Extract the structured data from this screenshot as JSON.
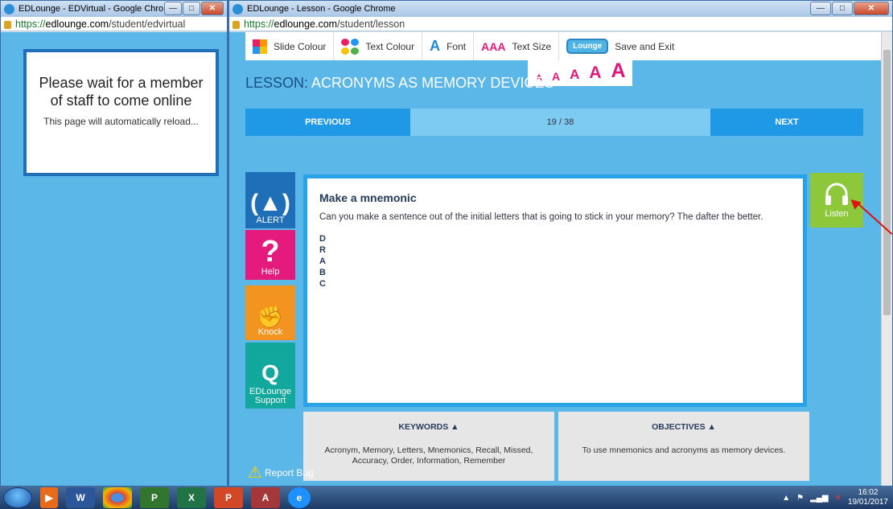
{
  "left_window": {
    "title": "EDLounge - EDVirtual - Google Chro...",
    "url_scheme": "https://",
    "url_domain": "edlounge.com",
    "url_path": "/student/edvirtual",
    "wait_message": "Please wait for a member of staff to come online",
    "reload_message": "This page will automatically reload..."
  },
  "right_window": {
    "title": "EDLounge - Lesson - Google Chrome",
    "url_scheme": "https://",
    "url_domain": "edlounge.com",
    "url_path": "/student/lesson"
  },
  "toolbar": {
    "slide_colour": "Slide Colour",
    "text_colour": "Text Colour",
    "font": "Font",
    "font_icon": "A",
    "text_size_icon": "AAA",
    "text_size": "Text Size",
    "logo": "Lounge",
    "save_exit": "Save and Exit",
    "size_options": [
      "A",
      "A",
      "A",
      "A",
      "A"
    ]
  },
  "lesson": {
    "label": "LESSON:",
    "name": "ACRONYMS AS MEMORY DEVICES",
    "previous": "PREVIOUS",
    "page": "19 / 38",
    "next": "NEXT"
  },
  "side_buttons": [
    {
      "label": "ALERT",
      "icon": "alert-icon",
      "color": "#1f6fb8"
    },
    {
      "label": "Help",
      "icon": "question-icon",
      "color": "#e41a7c"
    },
    {
      "label": "Knock",
      "icon": "fist-icon",
      "color": "#f39320"
    },
    {
      "label": "EDLounge Support",
      "icon": "q-icon",
      "color": "#13a89e"
    }
  ],
  "content": {
    "heading": "Make a mnemonic",
    "body": "Can you make a sentence out of the initial letters that is going to stick in your memory? The dafter the better.",
    "letters": [
      "D",
      "R",
      "A",
      "B",
      "C"
    ]
  },
  "listen": "Listen",
  "keywords": {
    "heading": "KEYWORDS",
    "text": "Acronym, Memory, Letters, Mnemonics, Recall, Missed, Accuracy, Order, Information, Remember"
  },
  "objectives": {
    "heading": "OBJECTIVES",
    "text": "To use mnemonics and acronyms as memory devices."
  },
  "report_bug": "Report Bug",
  "taskbar": {
    "apps": [
      "media-player",
      "word",
      "chrome",
      "project",
      "excel",
      "powerpoint",
      "access",
      "internet-explorer"
    ],
    "time": "16:02",
    "date": "19/01/2017"
  },
  "colors": {
    "lesson_bg": "#5ab7e8",
    "nav_button": "#1f98e6",
    "content_border": "#29a3e8",
    "listen": "#8cc83a"
  }
}
